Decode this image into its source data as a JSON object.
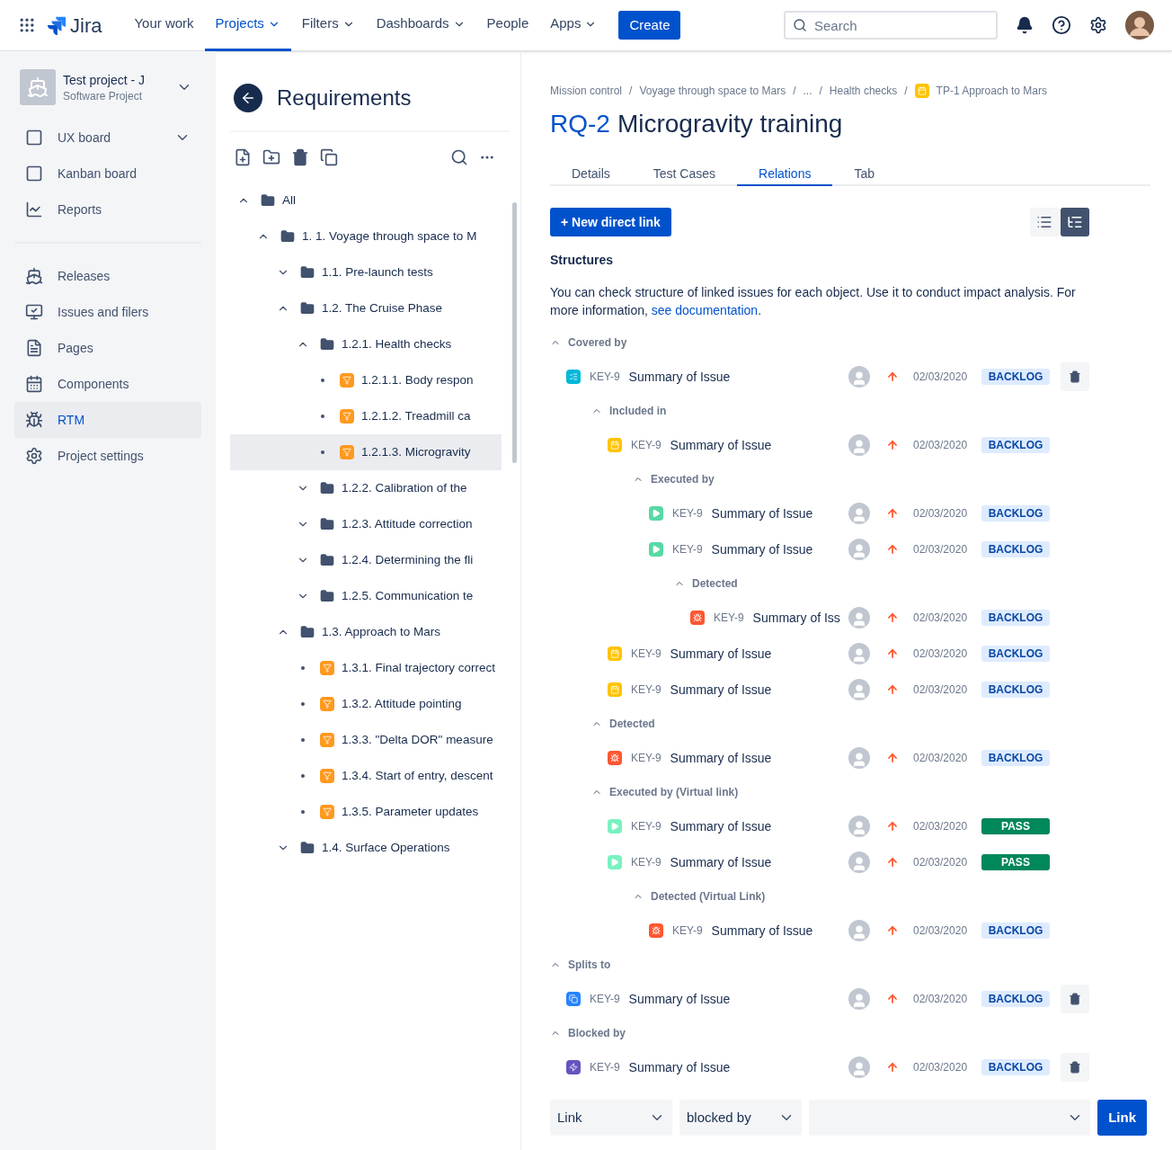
{
  "topbar": {
    "logo": "Jira",
    "nav": [
      {
        "label": "Your work",
        "selected": false,
        "dropdown": false
      },
      {
        "label": "Projects",
        "selected": true,
        "dropdown": true
      },
      {
        "label": "Filters",
        "selected": false,
        "dropdown": true
      },
      {
        "label": "Dashboards",
        "selected": false,
        "dropdown": true
      },
      {
        "label": "People",
        "selected": false,
        "dropdown": false
      },
      {
        "label": "Apps",
        "selected": false,
        "dropdown": true
      }
    ],
    "create": "Create",
    "search": {
      "placeholder": "Search"
    }
  },
  "sidebar": {
    "project": {
      "name": "Test project - J",
      "type": "Software Project"
    },
    "sections": [
      [
        {
          "label": "UX board",
          "selected": false,
          "expandable": true
        },
        {
          "label": "Kanban board",
          "selected": false,
          "expandable": false
        },
        {
          "label": "Reports",
          "selected": false,
          "expandable": false
        }
      ],
      [
        {
          "label": "Releases",
          "selected": false,
          "expandable": false
        },
        {
          "label": "Issues and filers",
          "selected": false,
          "expandable": false
        },
        {
          "label": "Pages",
          "selected": false,
          "expandable": false
        },
        {
          "label": "Components",
          "selected": false,
          "expandable": false
        },
        {
          "label": "RTM",
          "selected": true,
          "expandable": false
        },
        {
          "label": "Project settings",
          "selected": false,
          "expandable": false
        }
      ]
    ]
  },
  "tree_panel": {
    "title": "Requirements",
    "tree": [
      {
        "label": "All",
        "kind": "folder",
        "expanded": true,
        "selected": false,
        "children": [
          {
            "label": "1. 1. Voyage through space to M",
            "kind": "folder",
            "expanded": true,
            "selected": false,
            "children": [
              {
                "label": "1.1. Pre-launch tests",
                "kind": "folder",
                "expanded": false,
                "selected": false
              },
              {
                "label": "1.2. The Cruise Phase",
                "kind": "folder",
                "expanded": true,
                "selected": false,
                "children": [
                  {
                    "label": "1.2.1. Health checks",
                    "kind": "folder",
                    "expanded": true,
                    "selected": false,
                    "children": [
                      {
                        "label": "1.2.1.1. Body respon",
                        "kind": "requirement",
                        "selected": false
                      },
                      {
                        "label": "1.2.1.2. Treadmill ca",
                        "kind": "requirement",
                        "selected": false
                      },
                      {
                        "label": "1.2.1.3. Microgravity",
                        "kind": "requirement",
                        "selected": true
                      }
                    ]
                  },
                  {
                    "label": "1.2.2. Calibration of the",
                    "kind": "folder",
                    "expanded": false,
                    "selected": false
                  },
                  {
                    "label": "1.2.3. Attitude correction",
                    "kind": "folder",
                    "expanded": false,
                    "selected": false
                  },
                  {
                    "label": "1.2.4. Determining the fli",
                    "kind": "folder",
                    "expanded": false,
                    "selected": false
                  },
                  {
                    "label": "1.2.5. Communication te",
                    "kind": "folder",
                    "expanded": false,
                    "selected": false
                  }
                ]
              },
              {
                "label": "1.3. Approach to Mars",
                "kind": "folder",
                "expanded": true,
                "selected": false,
                "children": [
                  {
                    "label": "1.3.1. Final trajectory correct",
                    "kind": "requirement",
                    "selected": false
                  },
                  {
                    "label": "1.3.2. Attitude pointing",
                    "kind": "requirement",
                    "selected": false
                  },
                  {
                    "label": "1.3.3. \"Delta DOR\" measure",
                    "kind": "requirement",
                    "selected": false
                  },
                  {
                    "label": "1.3.4. Start of entry, descent",
                    "kind": "requirement",
                    "selected": false
                  },
                  {
                    "label": "1.3.5. Parameter updates",
                    "kind": "requirement",
                    "selected": false
                  }
                ]
              },
              {
                "label": "1.4. Surface Operations",
                "kind": "folder",
                "expanded": false,
                "selected": false
              }
            ]
          }
        ]
      }
    ]
  },
  "detail": {
    "breadcrumbs": [
      {
        "label": "Mission control",
        "kind": "text"
      },
      {
        "label": "/",
        "kind": "separator"
      },
      {
        "label": "Voyage through space to Mars",
        "kind": "text"
      },
      {
        "label": "/",
        "kind": "separator"
      },
      {
        "label": "...",
        "kind": "text"
      },
      {
        "label": "/",
        "kind": "separator"
      },
      {
        "label": "Health checks",
        "kind": "text"
      },
      {
        "label": "/",
        "kind": "separator"
      },
      {
        "label": "TP-1 Approach to Mars",
        "kind": "issue"
      }
    ],
    "key": "RQ-2",
    "title": "Microgravity training",
    "tabs": [
      {
        "label": "Details",
        "selected": false
      },
      {
        "label": "Test Cases",
        "selected": false
      },
      {
        "label": "Relations",
        "selected": true
      },
      {
        "label": "Tab",
        "selected": false
      }
    ],
    "new_link": "+ New direct link",
    "views": [
      {
        "kind": "list",
        "selected": false
      },
      {
        "kind": "tree",
        "selected": true
      }
    ],
    "heading": "Structures",
    "description": "You can check structure of linked issues for each object. Use it to conduct impact analysis. For more information,",
    "doc_link": "see documentation",
    "doc_end": ".",
    "groups": [
      {
        "label": "Covered by",
        "expanded": true,
        "items": [
          {
            "kind": "task",
            "key": "KEY-9",
            "summary": "Summary of Issue",
            "date": "02/03/2020",
            "status": {
              "label": "BACKLOG",
              "kind": "backlog"
            },
            "deletable": true,
            "groups": [
              {
                "label": "Included in",
                "expanded": true,
                "items": [
                  {
                    "kind": "requirement",
                    "key": "KEY-9",
                    "summary": "Summary of Issue",
                    "date": "02/03/2020",
                    "status": {
                      "label": "BACKLOG",
                      "kind": "backlog"
                    },
                    "deletable": false,
                    "groups": [
                      {
                        "label": "Executed by",
                        "expanded": true,
                        "items": [
                          {
                            "kind": "test",
                            "key": "KEY-9",
                            "summary": "Summary of Issue",
                            "date": "02/03/2020",
                            "status": {
                              "label": "BACKLOG",
                              "kind": "backlog"
                            },
                            "deletable": false
                          },
                          {
                            "kind": "test",
                            "key": "KEY-9",
                            "summary": "Summary of Issue",
                            "date": "02/03/2020",
                            "status": {
                              "label": "BACKLOG",
                              "kind": "backlog"
                            },
                            "deletable": false,
                            "groups": [
                              {
                                "label": "Detected",
                                "expanded": true,
                                "items": [
                                  {
                                    "kind": "bug",
                                    "key": "KEY-9",
                                    "summary": "Summary of Iss",
                                    "date": "02/03/2020",
                                    "status": {
                                      "label": "BACKLOG",
                                      "kind": "backlog"
                                    },
                                    "deletable": false
                                  }
                                ]
                              }
                            ]
                          }
                        ]
                      }
                    ]
                  },
                  {
                    "kind": "requirement",
                    "key": "KEY-9",
                    "summary": "Summary of Issue",
                    "date": "02/03/2020",
                    "status": {
                      "label": "BACKLOG",
                      "kind": "backlog"
                    },
                    "deletable": false
                  },
                  {
                    "kind": "requirement",
                    "key": "KEY-9",
                    "summary": "Summary of Issue",
                    "date": "02/03/2020",
                    "status": {
                      "label": "BACKLOG",
                      "kind": "backlog"
                    },
                    "deletable": false
                  }
                ]
              },
              {
                "label": "Detected",
                "expanded": true,
                "items": [
                  {
                    "kind": "bug",
                    "key": "KEY-9",
                    "summary": "Summary of Issue",
                    "date": "02/03/2020",
                    "status": {
                      "label": "BACKLOG",
                      "kind": "backlog"
                    },
                    "deletable": false
                  }
                ]
              },
              {
                "label": "Executed by (Virtual link)",
                "expanded": true,
                "items": [
                  {
                    "kind": "virtual-test",
                    "key": "KEY-9",
                    "summary": "Summary of Issue",
                    "date": "02/03/2020",
                    "status": {
                      "label": "PASS",
                      "kind": "pass"
                    },
                    "deletable": false
                  },
                  {
                    "kind": "virtual-test",
                    "key": "KEY-9",
                    "summary": "Summary of Issue",
                    "date": "02/03/2020",
                    "status": {
                      "label": "PASS",
                      "kind": "pass"
                    },
                    "deletable": false,
                    "groups": [
                      {
                        "label": "Detected (Virtual Link)",
                        "expanded": true,
                        "items": [
                          {
                            "kind": "bug",
                            "key": "KEY-9",
                            "summary": "Summary of Issue",
                            "date": "02/03/2020",
                            "status": {
                              "label": "BACKLOG",
                              "kind": "backlog"
                            },
                            "deletable": false
                          }
                        ]
                      }
                    ]
                  }
                ]
              }
            ]
          }
        ]
      },
      {
        "label": "Splits to",
        "expanded": true,
        "items": [
          {
            "kind": "story",
            "key": "KEY-9",
            "summary": "Summary of Issue",
            "date": "02/03/2020",
            "status": {
              "label": "BACKLOG",
              "kind": "backlog"
            },
            "deletable": true
          }
        ]
      },
      {
        "label": "Blocked by",
        "expanded": true,
        "items": [
          {
            "kind": "epic",
            "key": "KEY-9",
            "summary": "Summary of Issue",
            "date": "02/03/2020",
            "status": {
              "label": "BACKLOG",
              "kind": "backlog"
            },
            "deletable": true
          }
        ]
      }
    ],
    "link_form": {
      "selects": [
        {
          "value": "Link"
        },
        {
          "value": "blocked by"
        }
      ],
      "button": "Link"
    }
  }
}
